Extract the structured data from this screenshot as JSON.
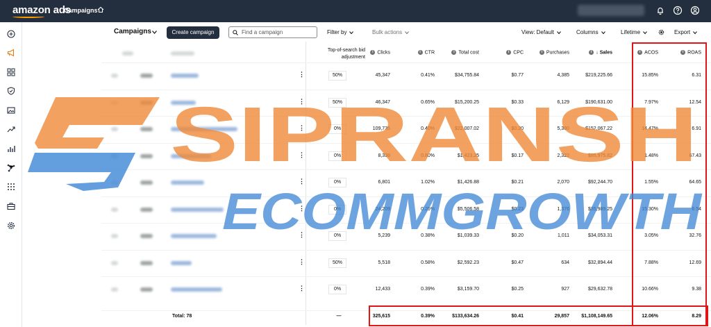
{
  "topbar": {
    "logo": "amazon ads",
    "title": "Campaigns"
  },
  "toolbar": {
    "campaigns_label": "Campaigns",
    "create_label": "Create campaign",
    "search_placeholder": "Find a campaign",
    "filter_label": "Filter by",
    "bulk_label": "Bulk actions",
    "view_label": "View: Default",
    "columns_label": "Columns",
    "date_label": "Lifetime",
    "export_label": "Export"
  },
  "table": {
    "headers": {
      "bid": "Top-of-search bid adjustment",
      "clicks": "Clicks",
      "ctr": "CTR",
      "cost": "Total cost",
      "cpc": "CPC",
      "purchases": "Purchases",
      "sales": "Sales",
      "acos": "ACOS",
      "roas": "ROAS"
    },
    "rows": [
      {
        "bid": "50%",
        "clicks": "45,347",
        "ctr": "0.41%",
        "cost": "$34,755.84",
        "cpc": "$0.77",
        "purchases": "4,385",
        "sales": "$219,225.66",
        "acos": "15.85%",
        "roas": "6.31"
      },
      {
        "bid": "50%",
        "clicks": "46,347",
        "ctr": "0.65%",
        "cost": "$15,200.25",
        "cpc": "$0.33",
        "purchases": "6,129",
        "sales": "$190,631.00",
        "acos": "7.97%",
        "roas": "12.54"
      },
      {
        "bid": "0%",
        "clicks": "109,735",
        "ctr": "0.40%",
        "cost": "$22,007.02",
        "cpc": "$0.20",
        "purchases": "5,380",
        "sales": "$152,067.22",
        "acos": "14.47%",
        "roas": "6.91"
      },
      {
        "bid": "0%",
        "clicks": "8,338",
        "ctr": "0.80%",
        "cost": "$1,423.25",
        "cpc": "$0.17",
        "purchases": "2,322",
        "sales": "$95,975.82",
        "acos": "1.48%",
        "roas": "67.43"
      },
      {
        "bid": "0%",
        "clicks": "6,801",
        "ctr": "1.02%",
        "cost": "$1,426.88",
        "cpc": "$0.21",
        "purchases": "2,070",
        "sales": "$92,244.70",
        "acos": "1.55%",
        "roas": "64.65"
      },
      {
        "bid": "0%",
        "clicks": "24,209",
        "ctr": "0.26%",
        "cost": "$5,506.58",
        "cpc": "$0.23",
        "purchases": "1,376",
        "sales": "$35,989.25",
        "acos": "15.30%",
        "roas": "6.54"
      },
      {
        "bid": "0%",
        "clicks": "5,239",
        "ctr": "0.38%",
        "cost": "$1,039.33",
        "cpc": "$0.20",
        "purchases": "1,011",
        "sales": "$34,053.31",
        "acos": "3.05%",
        "roas": "32.76"
      },
      {
        "bid": "50%",
        "clicks": "5,518",
        "ctr": "0.58%",
        "cost": "$2,592.23",
        "cpc": "$0.47",
        "purchases": "634",
        "sales": "$32,894.44",
        "acos": "7.88%",
        "roas": "12.69"
      },
      {
        "bid": "0%",
        "clicks": "12,433",
        "ctr": "0.39%",
        "cost": "$3,159.70",
        "cpc": "$0.25",
        "purchases": "927",
        "sales": "$29,632.78",
        "acos": "10.66%",
        "roas": "9.38"
      }
    ],
    "total": {
      "label": "Total: 78",
      "bid": "—",
      "clicks": "325,615",
      "ctr": "0.39%",
      "cost": "$133,634.26",
      "cpc": "$0.41",
      "purchases": "29,857",
      "sales": "$1,108,149.65",
      "acos": "12.06%",
      "roas": "8.29"
    }
  },
  "watermark": {
    "line1": "SIPRANSH",
    "line2": "ECOMMGROWTH"
  },
  "colors": {
    "topbar": "#232f3e",
    "accent": "#ff9900",
    "highlight": "#e01616",
    "watermark_orange": "#f08a3a",
    "watermark_blue": "#3d86d6"
  }
}
